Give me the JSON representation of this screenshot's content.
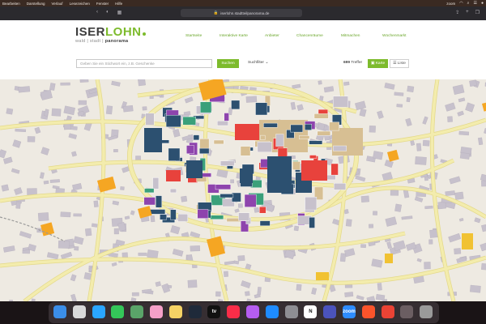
{
  "menubar": {
    "items": [
      "Bearbeiten",
      "Darstellung",
      "Verlauf",
      "Lesezeichen",
      "Fenster",
      "Hilfe"
    ],
    "right_label": "zoom"
  },
  "browser": {
    "url": "iserlohn.stadtteilpanorama.de"
  },
  "logo": {
    "part1": "ISER",
    "part2": "LOHN",
    "sub_1": "wald",
    "sub_2": "stadt",
    "sub_3": "panorama",
    "separator": "|"
  },
  "nav": {
    "items": [
      "Startseite",
      "Interaktive Karte",
      "Anbieter",
      "Chancenräume",
      "Mitmachen",
      "Wochenmarkt"
    ]
  },
  "search": {
    "placeholder": "Geben Sie ein Stichwort ein, z.B. Geschenke",
    "button": "Suchen"
  },
  "filter": {
    "label": "Suchfilter"
  },
  "results": {
    "count": "699",
    "label": "Treffer"
  },
  "view": {
    "map_label": "Karte",
    "list_label": "Liste"
  },
  "colors": {
    "accent": "#7dbb2c",
    "map_bg": "#eeeae2",
    "building": "#c7c1cc",
    "road": "#f3ecad",
    "navy": "#2c5070",
    "red": "#e8423c",
    "orange": "#f5a623",
    "tan": "#d7bf93"
  },
  "dock": {
    "apps": [
      "finder-icon",
      "launchpad-icon",
      "safari-icon",
      "messages-icon",
      "maps-icon",
      "photos-icon",
      "notes-icon",
      "activity-icon",
      "appletv-icon",
      "music-icon",
      "podcasts-icon",
      "appstore-icon",
      "settings-icon",
      "notion-icon",
      "teams-icon",
      "zoom-icon",
      "brave-icon",
      "chrome-icon",
      "preview-icon",
      "trash-icon"
    ],
    "zoom_label": "zoom",
    "tv_label": "tv",
    "notion_label": "N"
  }
}
